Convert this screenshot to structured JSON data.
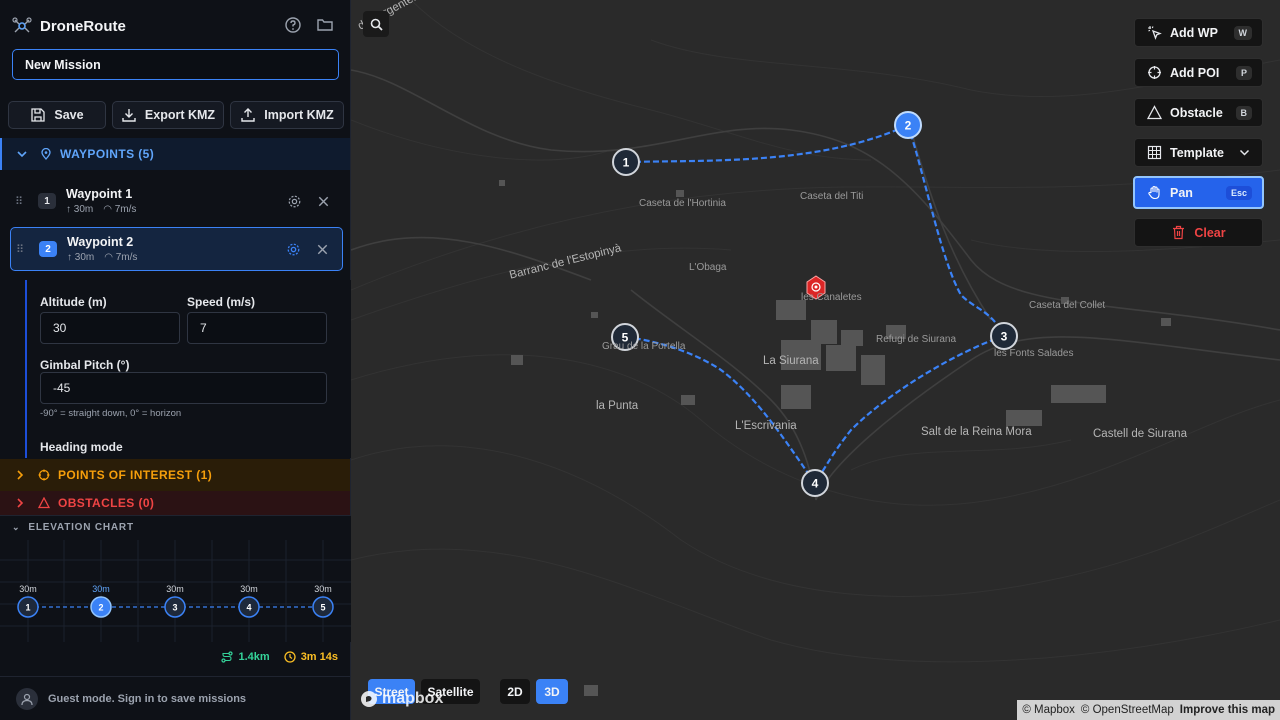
{
  "app": {
    "name": "DroneRoute"
  },
  "mission": {
    "name": "New Mission"
  },
  "actions": {
    "save": "Save",
    "export": "Export KMZ",
    "import": "Import KMZ"
  },
  "waypoints_section": {
    "title": "WAYPOINTS (5)"
  },
  "waypoints": [
    {
      "num": "1",
      "title": "Waypoint 1",
      "alt": "30m",
      "speed": "7m/s"
    },
    {
      "num": "2",
      "title": "Waypoint 2",
      "alt": "30m",
      "speed": "7m/s"
    }
  ],
  "editor": {
    "altitude_label": "Altitude (m)",
    "altitude_value": "30",
    "speed_label": "Speed (m/s)",
    "speed_value": "7",
    "gimbal_label": "Gimbal Pitch (°)",
    "gimbal_value": "-45",
    "gimbal_hint": "-90° = straight down, 0° = horizon",
    "heading_label": "Heading mode"
  },
  "poi_section": {
    "title": "POINTS OF INTEREST (1)"
  },
  "obstacles_section": {
    "title": "OBSTACLES (0)"
  },
  "elevation": {
    "title": "ELEVATION CHART",
    "points": [
      {
        "num": "1",
        "alt": "30m"
      },
      {
        "num": "2",
        "alt": "30m"
      },
      {
        "num": "3",
        "alt": "30m"
      },
      {
        "num": "4",
        "alt": "30m"
      },
      {
        "num": "5",
        "alt": "30m"
      }
    ]
  },
  "stats": {
    "distance": "1.4km",
    "duration": "3m 14s"
  },
  "footer": {
    "text": "Guest mode. Sign in to save missions"
  },
  "tools": {
    "add_wp": "Add WP",
    "add_wp_key": "W",
    "add_poi": "Add POI",
    "add_poi_key": "P",
    "obstacle": "Obstacle",
    "obstacle_key": "B",
    "template": "Template",
    "pan": "Pan",
    "pan_key": "Esc",
    "clear": "Clear"
  },
  "map_controls": {
    "street": "Street",
    "satellite": "Satellite",
    "d2": "2D",
    "d3": "3D"
  },
  "map_markers": [
    "1",
    "2",
    "3",
    "4",
    "5"
  ],
  "place_labels": {
    "argentera": "de l'Argenter",
    "hortinia": "Caseta de l'Hortinia",
    "titi": "Caseta del Titi",
    "estopinya": "Barranc de l'Estopinyà",
    "obaga": "L'Obaga",
    "canaletes": "les Canaletes",
    "collet": "Caseta del Collet",
    "portella": "Grau de la Portella",
    "refugi": "Refugi de Siurana",
    "fonts": "les Fonts Salades",
    "siurana_town": "La Siurana",
    "punta": "la Punta",
    "escrivania": "L'Escrivania",
    "salt": "Salt de la Reina Mora",
    "castell": "Castell de Siurana"
  },
  "attribution": {
    "mapbox": "© Mapbox",
    "osm": "© OpenStreetMap",
    "improve": "Improve this map",
    "logo": "mapbox"
  },
  "colors": {
    "accent": "#3b82f6",
    "poi": "#f59e0b",
    "obstacle": "#ef4444",
    "distance": "#34d399",
    "duration": "#fbbf24"
  }
}
